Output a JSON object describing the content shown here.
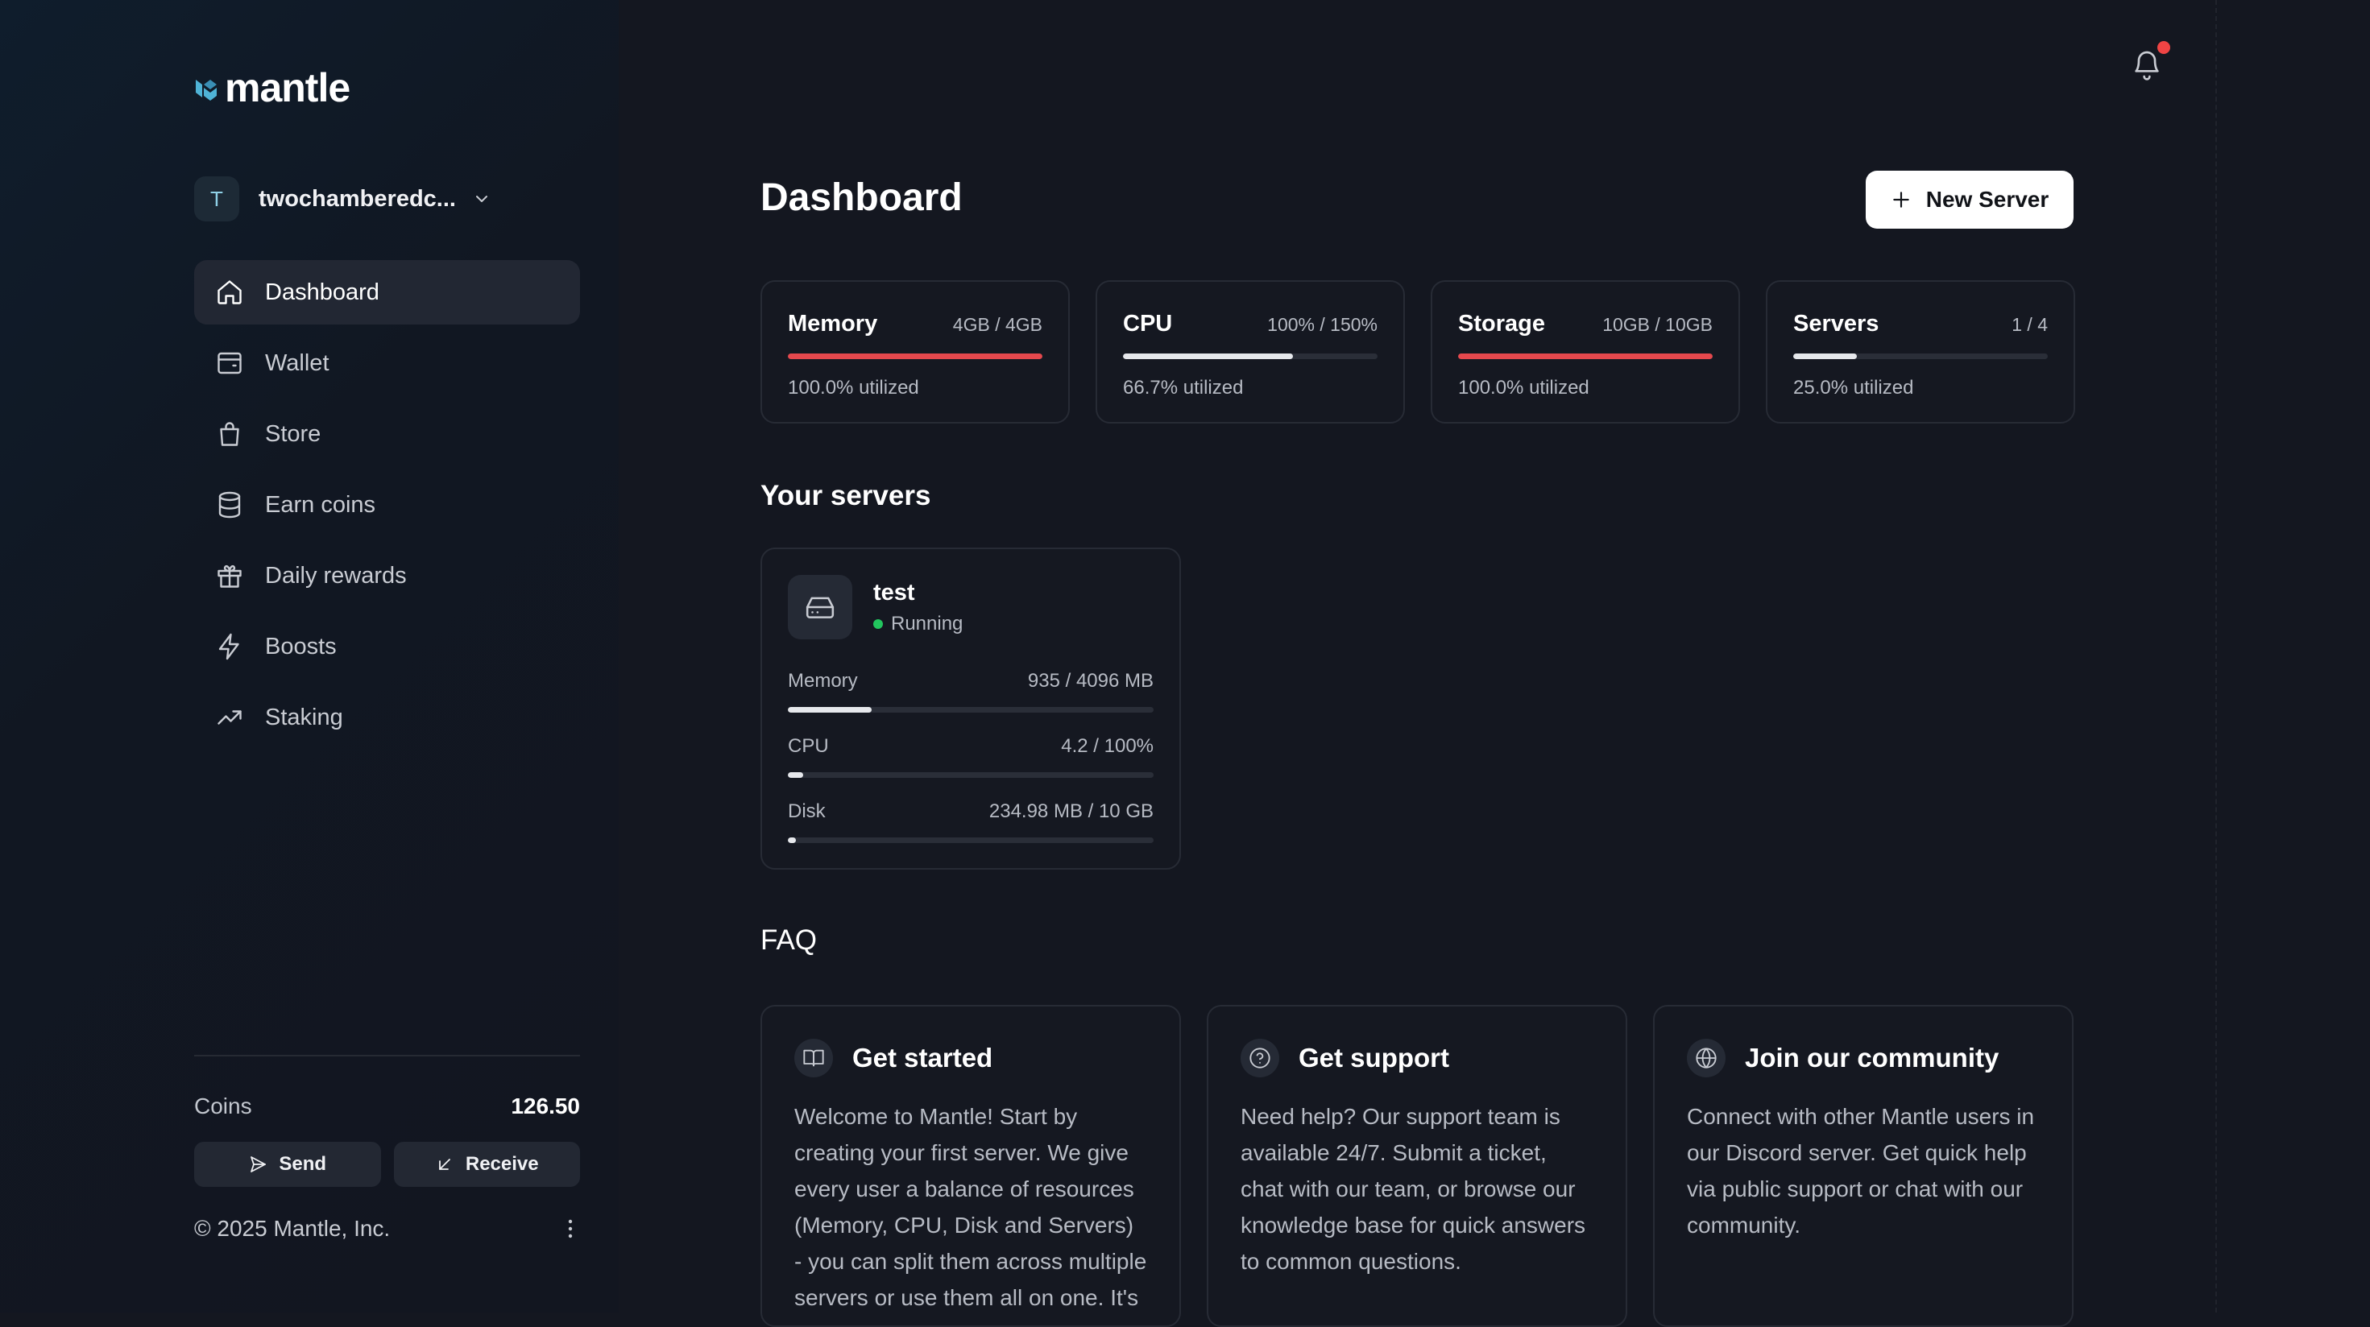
{
  "brand": {
    "name": "mantle"
  },
  "account": {
    "initial": "T",
    "name": "twochamberedc..."
  },
  "sidebar": {
    "items": [
      {
        "label": "Dashboard",
        "icon": "home-icon",
        "active": true
      },
      {
        "label": "Wallet",
        "icon": "wallet-icon"
      },
      {
        "label": "Store",
        "icon": "shopping-bag-icon"
      },
      {
        "label": "Earn coins",
        "icon": "database-icon"
      },
      {
        "label": "Daily rewards",
        "icon": "gift-icon"
      },
      {
        "label": "Boosts",
        "icon": "lightning-icon"
      },
      {
        "label": "Staking",
        "icon": "trending-up-icon"
      }
    ]
  },
  "wallet": {
    "coins_label": "Coins",
    "coins_value": "126.50",
    "send_label": "Send",
    "receive_label": "Receive"
  },
  "footer": {
    "copyright": "© 2025 Mantle, Inc."
  },
  "header": {
    "title": "Dashboard",
    "new_server_label": "New Server",
    "notification_dot": true
  },
  "stats": [
    {
      "name": "Memory",
      "value": "4GB / 4GB",
      "utilized": "100.0% utilized",
      "fraction": 1.0,
      "color": "#e5484d"
    },
    {
      "name": "CPU",
      "value": "100% / 150%",
      "utilized": "66.7% utilized",
      "fraction": 0.667,
      "color": "#e6e8ec"
    },
    {
      "name": "Storage",
      "value": "10GB / 10GB",
      "utilized": "100.0% utilized",
      "fraction": 1.0,
      "color": "#e5484d"
    },
    {
      "name": "Servers",
      "value": "1 / 4",
      "utilized": "25.0% utilized",
      "fraction": 0.25,
      "color": "#e6e8ec"
    }
  ],
  "servers_section": {
    "title": "Your servers"
  },
  "servers": [
    {
      "name": "test",
      "status": "Running",
      "status_color": "#22c55e",
      "resources": [
        {
          "label": "Memory",
          "value": "935 / 4096 MB",
          "fraction": 0.228
        },
        {
          "label": "CPU",
          "value": "4.2 / 100%",
          "fraction": 0.042
        },
        {
          "label": "Disk",
          "value": "234.98 MB / 10 GB",
          "fraction": 0.023
        }
      ]
    }
  ],
  "faq_section": {
    "title": "FAQ"
  },
  "faq": [
    {
      "title": "Get started",
      "icon": "book-icon",
      "body": "Welcome to Mantle! Start by creating your first server. We give every user a balance of resources (Memory, CPU, Disk and Servers) - you can split them across multiple servers or use them all on one. It's"
    },
    {
      "title": "Get support",
      "icon": "help-circle-icon",
      "body": "Need help? Our support team is available 24/7. Submit a ticket, chat with our team, or browse our knowledge base for quick answers to common questions."
    },
    {
      "title": "Join our community",
      "icon": "globe-icon",
      "body": "Connect with other Mantle users in our Discord server. Get quick help via public support or chat with our community."
    }
  ]
}
